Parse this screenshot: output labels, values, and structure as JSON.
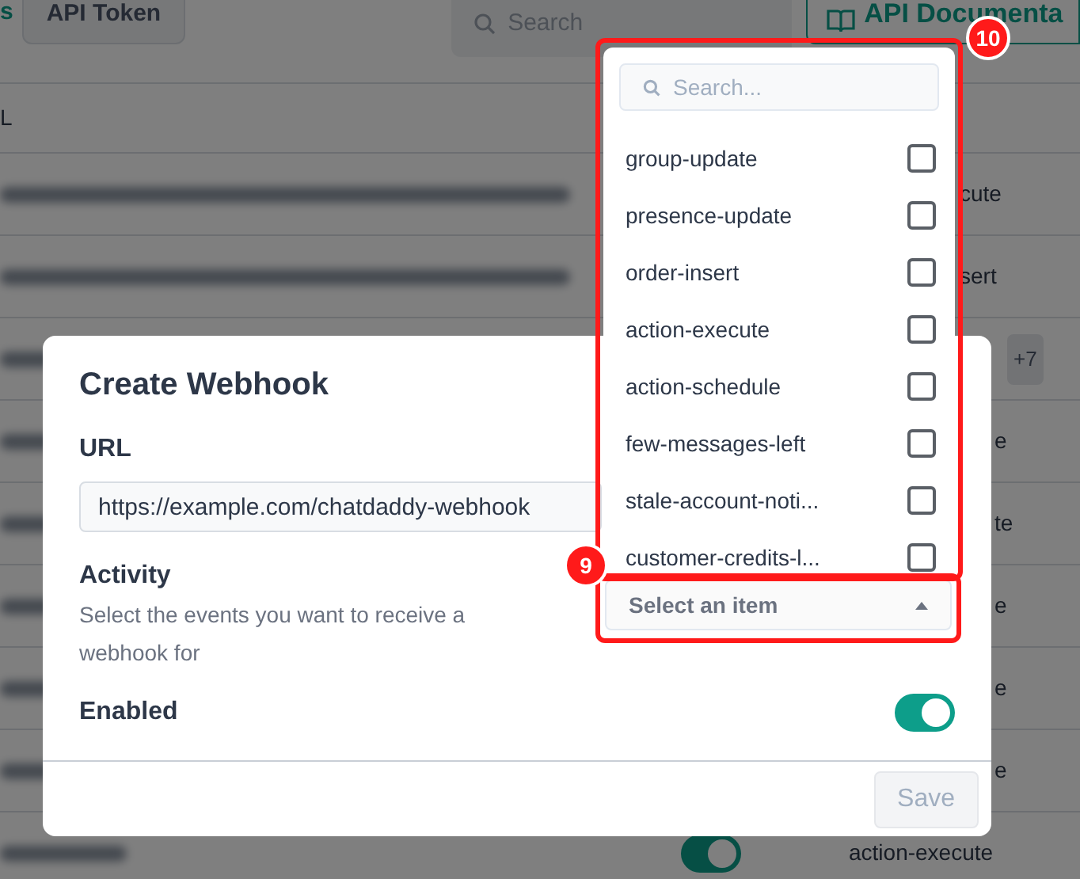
{
  "background": {
    "tabs": [
      {
        "label": "s",
        "selected": true
      },
      {
        "label": "API Token",
        "selected": false
      }
    ],
    "search": {
      "placeholder": "Search"
    },
    "docs_button": {
      "label": "API Documenta"
    },
    "table": {
      "columns": [
        "L"
      ],
      "rows": [
        {
          "events": "cute"
        },
        {
          "events": "sert"
        },
        {
          "events": "+7",
          "kind": "badge"
        },
        {
          "events": "e"
        },
        {
          "events": "te"
        },
        {
          "events": "e"
        },
        {
          "events": "e"
        },
        {
          "events": "e"
        },
        {
          "events": "action-execute",
          "enabled": true
        }
      ]
    }
  },
  "modal": {
    "title": "Create Webhook",
    "url_label": "URL",
    "url_value": "https://example.com/chatdaddy-webhook",
    "activity_label": "Activity",
    "activity_help": "Select the events you want to receive a webhook for",
    "enabled_label": "Enabled",
    "enabled": true,
    "save_button": {
      "label": "Save",
      "disabled": true
    }
  },
  "dropdown": {
    "search": {
      "placeholder": "Search..."
    },
    "items": [
      {
        "label": "group-update",
        "checked": false
      },
      {
        "label": "presence-update",
        "checked": false
      },
      {
        "label": "order-insert",
        "checked": false
      },
      {
        "label": "action-execute",
        "checked": false
      },
      {
        "label": "action-schedule",
        "checked": false
      },
      {
        "label": "few-messages-left",
        "checked": false
      },
      {
        "label": "stale-account-noti...",
        "checked": false
      },
      {
        "label": "customer-credits-l...",
        "checked": false
      }
    ],
    "select": {
      "placeholder": "Select an item",
      "expanded": true
    }
  },
  "annotations": [
    {
      "number": "10"
    },
    {
      "number": "9"
    }
  ]
}
